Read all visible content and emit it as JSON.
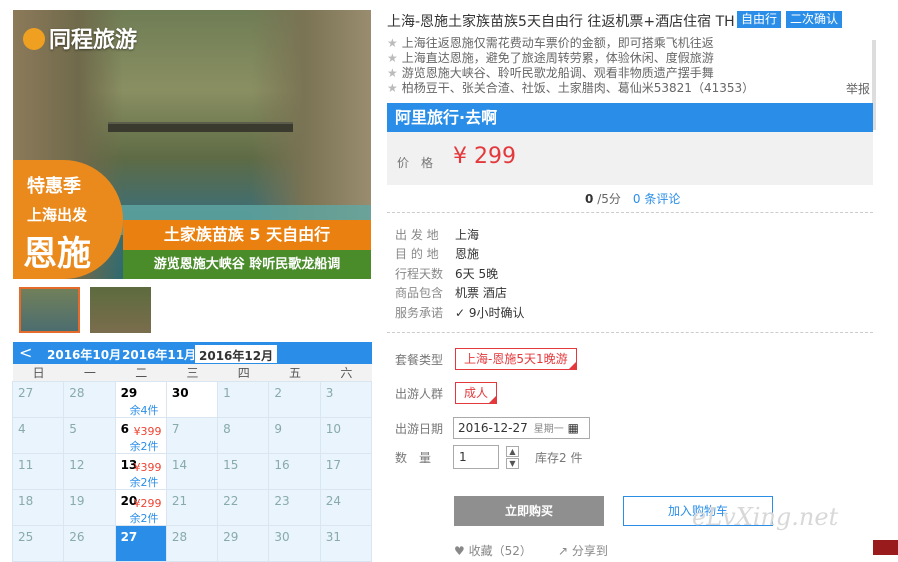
{
  "hero": {
    "logo": "同程旅游",
    "badge_line1": "特惠季",
    "badge_line2": "上海出发",
    "badge_line3": "恩施",
    "band1": "土家族苗族 5 天自由行",
    "band2": "游览恩施大峡谷 聆听民歌龙船调"
  },
  "calendar": {
    "prev": "<",
    "months": [
      "2016年10月",
      "2016年11月",
      "2016年12月"
    ],
    "weekdays": [
      "日",
      "一",
      "二",
      "三",
      "四",
      "五",
      "六"
    ],
    "rows": [
      [
        {
          "d": "27"
        },
        {
          "d": "28"
        },
        {
          "d": "29",
          "active": true,
          "sub": "余4件"
        },
        {
          "d": "30",
          "active": true
        },
        {
          "d": "1"
        },
        {
          "d": "2"
        },
        {
          "d": "3"
        }
      ],
      [
        {
          "d": "4"
        },
        {
          "d": "5"
        },
        {
          "d": "6",
          "active": true,
          "price": "¥399",
          "sub": "余2件"
        },
        {
          "d": "7"
        },
        {
          "d": "8"
        },
        {
          "d": "9"
        },
        {
          "d": "10"
        }
      ],
      [
        {
          "d": "11"
        },
        {
          "d": "12"
        },
        {
          "d": "13",
          "active": true,
          "price": "¥399",
          "sub": "余2件"
        },
        {
          "d": "14"
        },
        {
          "d": "15"
        },
        {
          "d": "16"
        },
        {
          "d": "17"
        }
      ],
      [
        {
          "d": "18"
        },
        {
          "d": "19"
        },
        {
          "d": "20",
          "active": true,
          "price": "¥299",
          "sub": "余2件"
        },
        {
          "d": "21"
        },
        {
          "d": "22"
        },
        {
          "d": "23"
        },
        {
          "d": "24"
        }
      ],
      [
        {
          "d": "25"
        },
        {
          "d": "26"
        },
        {
          "d": "27",
          "today": true
        },
        {
          "d": "28"
        },
        {
          "d": "29"
        },
        {
          "d": "30"
        },
        {
          "d": "31"
        }
      ]
    ]
  },
  "product": {
    "title": "上海-恩施土家族苗族5天自由行 往返机票+酒店住宿 TH",
    "tags": [
      "自由行",
      "二次确认"
    ],
    "features": [
      "上海往返恩施仅需花费动车票价的金额，即可搭乘飞机往返",
      "上海直达恩施，避免了旅途周转劳累，体验休闲、度假旅游",
      "游览恩施大峡谷、聆听民歌龙船调、观看非物质遗产摆手舞",
      "柏杨豆干、张关合渣、社饭、土家腊肉、葛仙米53821（41353）"
    ],
    "report": "举报",
    "agency": "阿里旅行·去啊",
    "price_label": "价　格",
    "price": "¥ 299",
    "score": "0",
    "score_total": "/5分",
    "reviews": "0 条评论"
  },
  "info": [
    {
      "k": "出 发 地",
      "v": "上海"
    },
    {
      "k": "目 的 地",
      "v": "恩施"
    },
    {
      "k": "行程天数",
      "v": "6天 5晚"
    },
    {
      "k": "商品包含",
      "v": "机票  酒店"
    },
    {
      "k": "服务承诺",
      "v": "9小时确认"
    }
  ],
  "options": {
    "package_label": "套餐类型",
    "package_value": "上海-恩施5天1晚游",
    "people_label": "出游人群",
    "people_value": "成人",
    "date_label": "出游日期",
    "date_value": "2016-12-27",
    "date_weekday": "星期一",
    "qty_label": "数　量",
    "qty_value": "1",
    "stock": "库存2 件",
    "buy": "立即购买",
    "cart": "加入购物车",
    "fav": "收藏（52）",
    "share": "分享到"
  },
  "watermark": "eLvXing.net"
}
